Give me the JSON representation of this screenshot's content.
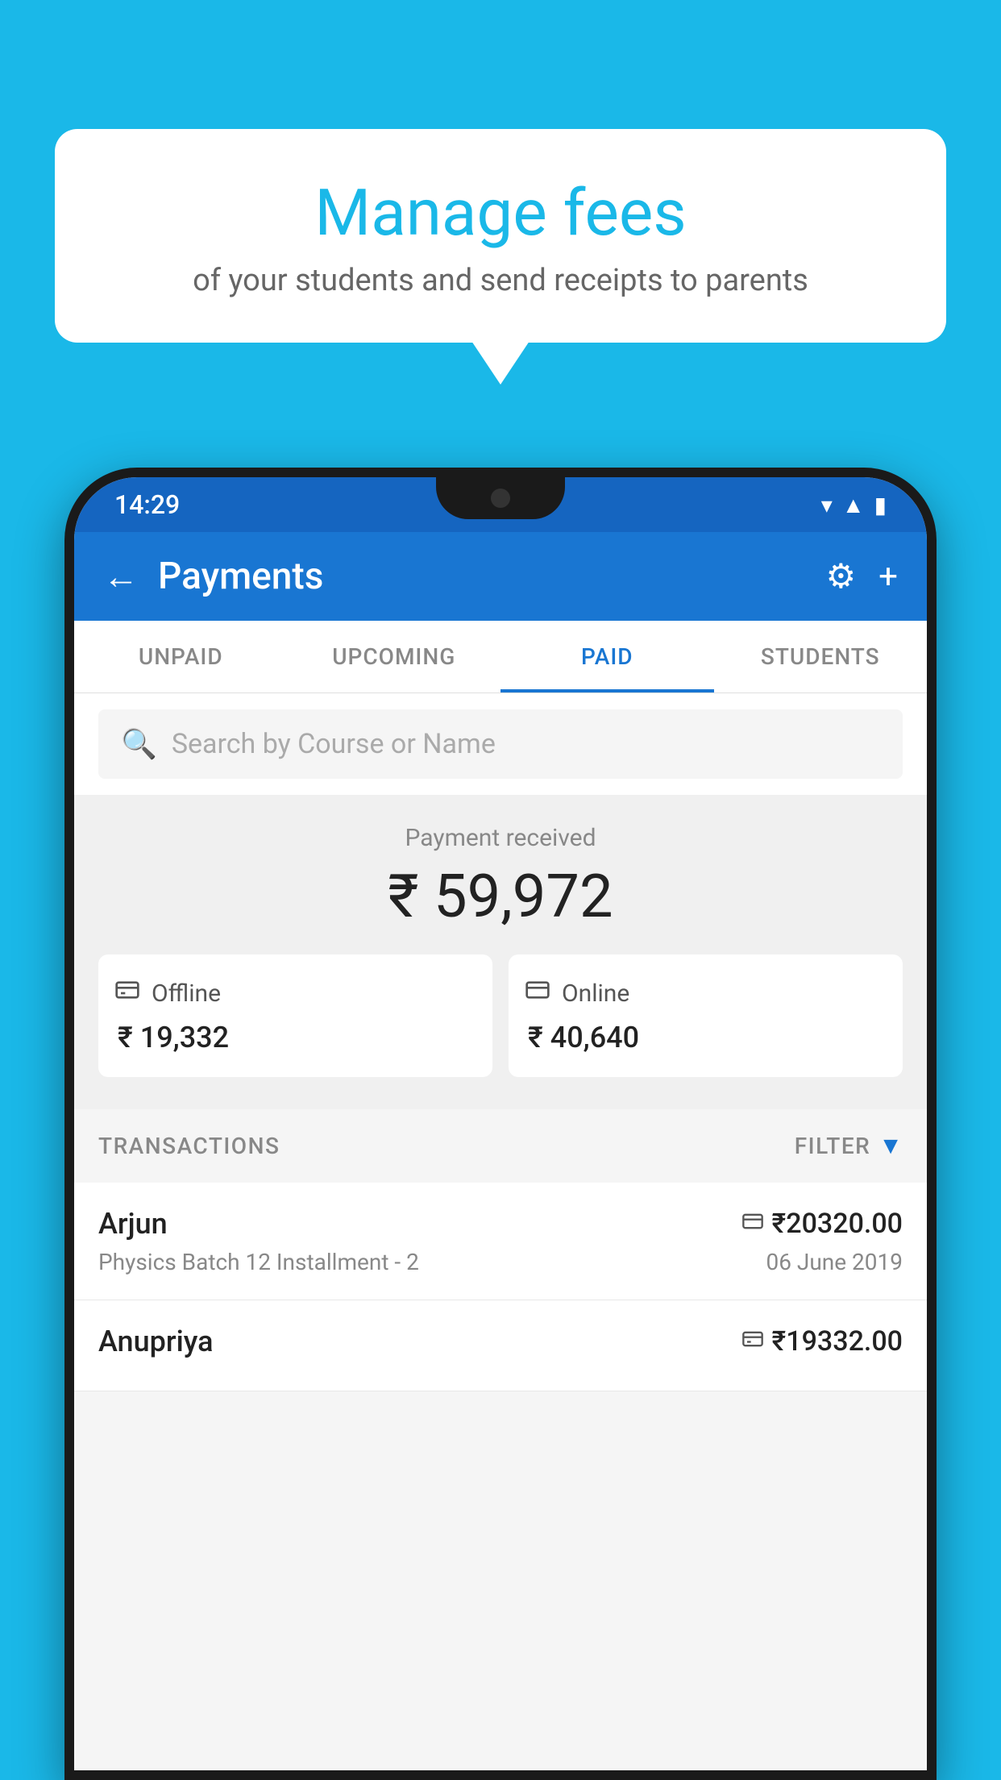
{
  "background": {
    "color": "#1AB8E8"
  },
  "speech_bubble": {
    "title": "Manage fees",
    "subtitle": "of your students and send receipts to parents"
  },
  "status_bar": {
    "time": "14:29",
    "wifi_icon": "▾",
    "signal_icon": "▲",
    "battery_icon": "▮"
  },
  "app_bar": {
    "title": "Payments",
    "back_label": "←",
    "settings_label": "⚙",
    "add_label": "+"
  },
  "tabs": [
    {
      "label": "UNPAID",
      "active": false
    },
    {
      "label": "UPCOMING",
      "active": false
    },
    {
      "label": "PAID",
      "active": true
    },
    {
      "label": "STUDENTS",
      "active": false
    }
  ],
  "search": {
    "placeholder": "Search by Course or Name"
  },
  "payment_received": {
    "label": "Payment received",
    "total_amount": "₹ 59,972",
    "offline": {
      "icon": "💳",
      "label": "Offline",
      "amount": "₹ 19,332"
    },
    "online": {
      "icon": "💳",
      "label": "Online",
      "amount": "₹ 40,640"
    }
  },
  "transactions": {
    "header_label": "TRANSACTIONS",
    "filter_label": "FILTER",
    "items": [
      {
        "name": "Arjun",
        "amount": "₹20320.00",
        "course": "Physics Batch 12 Installment - 2",
        "date": "06 June 2019",
        "payment_type": "online"
      },
      {
        "name": "Anupriya",
        "amount": "₹19332.00",
        "course": "",
        "date": "",
        "payment_type": "offline"
      }
    ]
  }
}
